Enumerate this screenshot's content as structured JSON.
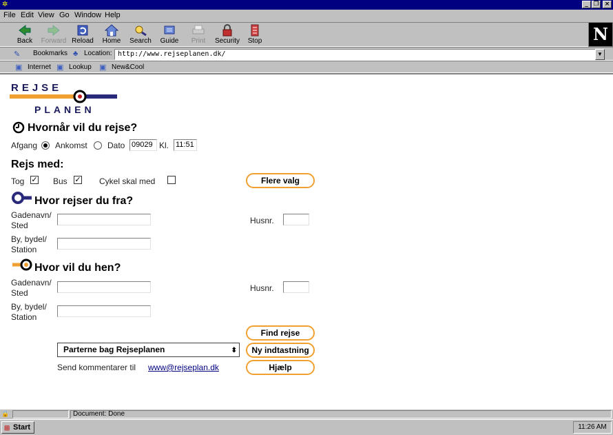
{
  "menu": [
    "File",
    "Edit",
    "View",
    "Go",
    "Window",
    "Help"
  ],
  "toolbar": [
    {
      "label": "Back",
      "icon": "back-arrow-icon",
      "disabled": false
    },
    {
      "label": "Forward",
      "icon": "forward-arrow-icon",
      "disabled": true
    },
    {
      "label": "Reload",
      "icon": "reload-icon",
      "disabled": false
    },
    {
      "label": "Home",
      "icon": "home-icon",
      "disabled": false
    },
    {
      "label": "Search",
      "icon": "search-icon",
      "disabled": false
    },
    {
      "label": "Guide",
      "icon": "guide-icon",
      "disabled": false
    },
    {
      "label": "Print",
      "icon": "print-icon",
      "disabled": true
    },
    {
      "label": "Security",
      "icon": "lock-icon",
      "disabled": false
    },
    {
      "label": "Stop",
      "icon": "stop-icon",
      "disabled": false
    }
  ],
  "logo_letter": "N",
  "location": {
    "bookmarks_label": "Bookmarks",
    "location_label": "Location:",
    "url": "http://www.rejseplanen.dk/"
  },
  "personal": [
    "Internet",
    "Lookup",
    "New&Cool"
  ],
  "site_logo": {
    "top": "REJSE",
    "bottom": "PLANEN"
  },
  "when": {
    "heading": "Hvornår vil du rejse?",
    "afgang": "Afgang",
    "ankomst": "Ankomst",
    "dato_label": "Dato",
    "dato_value": "09029",
    "kl_label": "Kl.",
    "kl_value": "11:51"
  },
  "mode": {
    "heading": "Rejs med:",
    "tog": "Tog",
    "bus": "Bus",
    "cykel": "Cykel skal med",
    "tog_checked": true,
    "bus_checked": true,
    "cykel_checked": false,
    "flere_valg": "Flere valg"
  },
  "from": {
    "heading": "Hvor rejser du fra?",
    "gade_l1": "Gadenavn/",
    "gade_l2": "Sted",
    "by_l1": "By, bydel/",
    "by_l2": "Station",
    "husnr": "Husnr."
  },
  "to": {
    "heading": "Hvor vil du hen?",
    "gade_l1": "Gadenavn/",
    "gade_l2": "Sted",
    "by_l1": "By, bydel/",
    "by_l2": "Station",
    "husnr": "Husnr."
  },
  "buttons": {
    "find": "Find rejse",
    "ny": "Ny indtastning",
    "hjaelp": "Hjælp"
  },
  "select_value": "Parterne bag Rejseplanen",
  "comment_text": "Send kommentarer til",
  "comment_link": "www@rejseplan.dk",
  "status": "Document: Done",
  "start": "Start",
  "clock": "11:26 AM",
  "colors": {
    "accent_orange": "#f0a030",
    "accent_navy": "#2a2a7a",
    "titlebar": "#000080"
  }
}
